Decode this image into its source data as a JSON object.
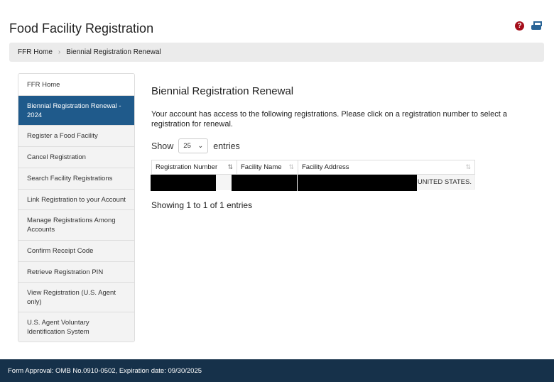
{
  "header": {
    "title": "Food Facility Registration",
    "help_icon": "question-circle-icon",
    "print_icon": "print-icon",
    "help_color": "#a50e1a"
  },
  "breadcrumb": {
    "items": [
      "FFR Home",
      "Biennial Registration Renewal"
    ],
    "separator": "›"
  },
  "sidebar": {
    "items": [
      {
        "label": "FFR Home"
      },
      {
        "label": "Biennial Registration Renewal - 2024",
        "active": true
      },
      {
        "label": "Register a Food Facility"
      },
      {
        "label": "Cancel Registration"
      },
      {
        "label": "Search Facility Registrations"
      },
      {
        "label": "Link Registration to your Account"
      },
      {
        "label": "Manage Registrations Among Accounts"
      },
      {
        "label": "Confirm Receipt Code"
      },
      {
        "label": "Retrieve Registration PIN"
      },
      {
        "label": "View Registration (U.S. Agent only)"
      },
      {
        "label": "U.S. Agent Voluntary Identification System"
      }
    ]
  },
  "main": {
    "title": "Biennial Registration Renewal",
    "intro": "Your account has access to the following registrations. Please click on a registration number to select a registration for renewal.",
    "show_label": "Show",
    "entries_label": "entries",
    "page_size": "25",
    "columns": [
      "Registration Number",
      "Facility Name",
      "Facility Address"
    ],
    "rows": [
      {
        "address_suffix": "UNITED STATES."
      }
    ],
    "info": "Showing 1 to 1 of 1 entries"
  },
  "footer": {
    "text": "Form Approval: OMB No.0910-0502, Expiration date: 09/30/2025"
  }
}
